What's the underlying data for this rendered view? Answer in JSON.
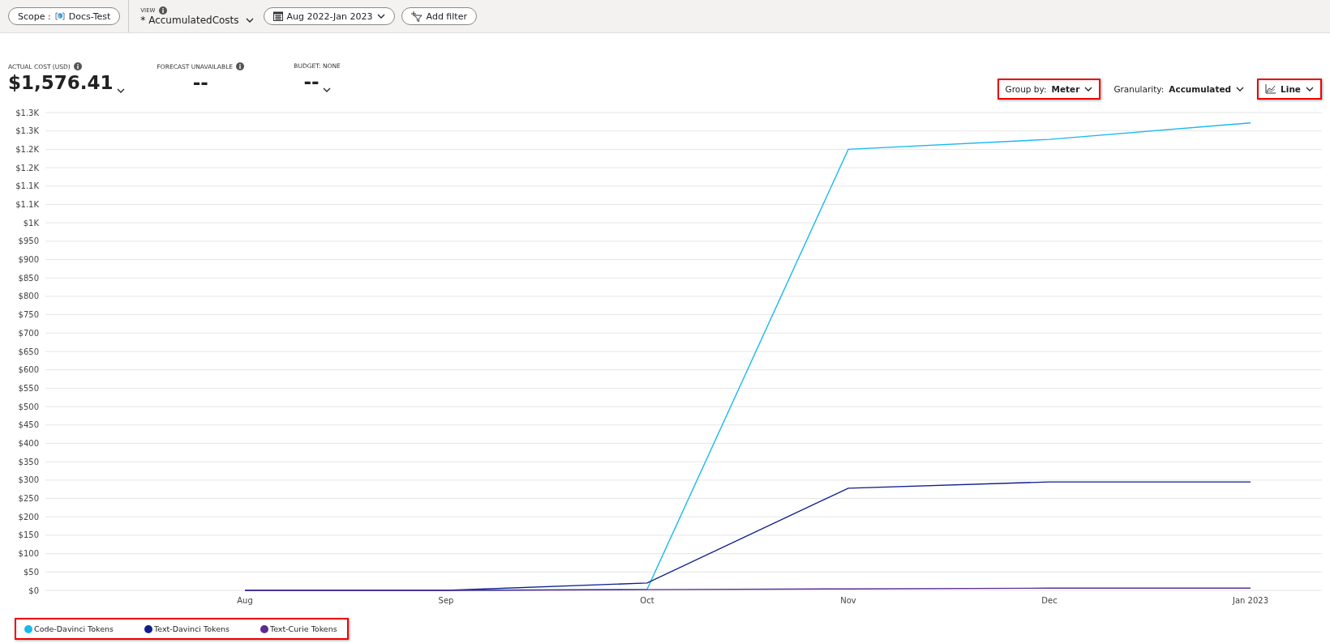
{
  "toolbar": {
    "scope": {
      "label": "Scope :",
      "value": "Docs-Test"
    },
    "view": {
      "label": "VIEW",
      "value": "* AccumulatedCosts"
    },
    "date_range": "Aug 2022-Jan 2023",
    "add_filter": "Add filter"
  },
  "kpis": [
    {
      "label": "ACTUAL COST (USD)",
      "value": "$1,576.41",
      "info": true,
      "dropdown": true
    },
    {
      "label": "FORECAST UNAVAILABLE",
      "value": "--",
      "info": true,
      "dropdown": false
    },
    {
      "label": "BUDGET: NONE",
      "value": "--",
      "info": false,
      "dropdown": true
    }
  ],
  "controls": [
    {
      "kind": "group_by",
      "label": "Group by:",
      "value": "Meter",
      "highlighted": true
    },
    {
      "kind": "granularity",
      "label": "Granularity:",
      "value": "Accumulated",
      "highlighted": false
    },
    {
      "kind": "chart_type",
      "value": "Line",
      "highlighted": true
    }
  ],
  "chart_data": {
    "type": "line",
    "grid": true,
    "categories": [
      "Aug",
      "Sep",
      "Oct",
      "Nov",
      "Dec",
      "Jan 2023"
    ],
    "ylim": [
      0,
      1300
    ],
    "yticks": [
      {
        "value": 0,
        "label": "$0"
      },
      {
        "value": 50,
        "label": "$50"
      },
      {
        "value": 100,
        "label": "$100"
      },
      {
        "value": 150,
        "label": "$150"
      },
      {
        "value": 200,
        "label": "$200"
      },
      {
        "value": 250,
        "label": "$250"
      },
      {
        "value": 300,
        "label": "$300"
      },
      {
        "value": 350,
        "label": "$350"
      },
      {
        "value": 400,
        "label": "$400"
      },
      {
        "value": 450,
        "label": "$450"
      },
      {
        "value": 500,
        "label": "$500"
      },
      {
        "value": 550,
        "label": "$550"
      },
      {
        "value": 600,
        "label": "$600"
      },
      {
        "value": 650,
        "label": "$650"
      },
      {
        "value": 700,
        "label": "$700"
      },
      {
        "value": 750,
        "label": "$750"
      },
      {
        "value": 800,
        "label": "$800"
      },
      {
        "value": 850,
        "label": "$850"
      },
      {
        "value": 900,
        "label": "$900"
      },
      {
        "value": 950,
        "label": "$950"
      },
      {
        "value": 1000,
        "label": "$1K"
      },
      {
        "value": 1050,
        "label": "$1.1K"
      },
      {
        "value": 1100,
        "label": "$1.1K"
      },
      {
        "value": 1150,
        "label": "$1.2K"
      },
      {
        "value": 1200,
        "label": "$1.2K"
      },
      {
        "value": 1250,
        "label": "$1.3K"
      },
      {
        "value": 1300,
        "label": "$1.3K"
      }
    ],
    "series": [
      {
        "name": "Code-Davinci Tokens",
        "color": "#1ab9ec",
        "values": [
          0,
          0,
          3,
          1200,
          1227,
          1272
        ]
      },
      {
        "name": "Text-Davinci Tokens",
        "color": "#0f1f8c",
        "values": [
          0,
          0,
          20,
          278,
          295,
          295
        ]
      },
      {
        "name": "Text-Curie Tokens",
        "color": "#5c2d91",
        "values": [
          0,
          0,
          2,
          4,
          6,
          6
        ]
      }
    ]
  },
  "legend": {
    "highlighted": true
  }
}
